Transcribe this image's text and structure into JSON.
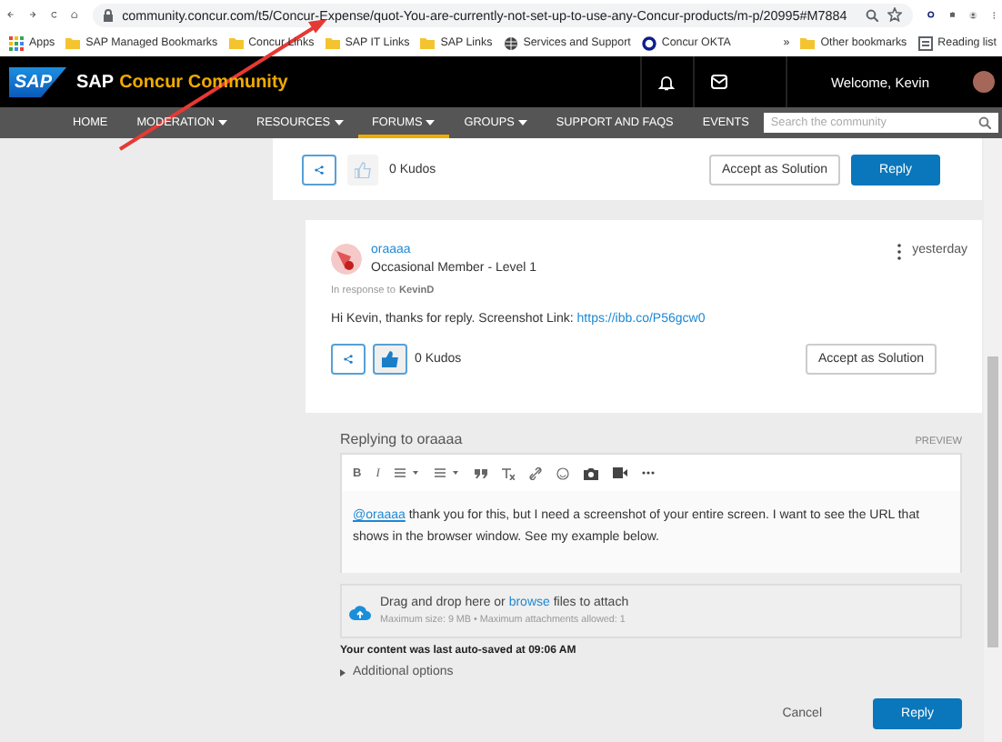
{
  "browser": {
    "url": "community.concur.com/t5/Concur-Expense/quot-You-are-currently-not-set-up-to-use-any-Concur-products/m-p/20995#M7884",
    "bookmarks": [
      {
        "kind": "apps",
        "label": "Apps"
      },
      {
        "kind": "folder",
        "label": "SAP Managed Bookmarks"
      },
      {
        "kind": "folder",
        "label": "Concur Links"
      },
      {
        "kind": "folder",
        "label": "SAP IT Links"
      },
      {
        "kind": "folder",
        "label": "SAP Links"
      },
      {
        "kind": "globe",
        "label": "Services and Support"
      },
      {
        "kind": "ring",
        "label": "Concur OKTA"
      }
    ],
    "overflow": "»",
    "other_bookmarks": "Other bookmarks",
    "reading_list": "Reading list"
  },
  "header": {
    "logo": "SAP",
    "title_brand": "SAP",
    "title_rest": "Concur Community",
    "welcome": "Welcome, Kevin"
  },
  "nav": {
    "items": [
      {
        "label": "HOME",
        "dropdown": false,
        "selected": false
      },
      {
        "label": "MODERATION",
        "dropdown": true,
        "selected": false
      },
      {
        "label": "RESOURCES",
        "dropdown": true,
        "selected": false
      },
      {
        "label": "FORUMS",
        "dropdown": true,
        "selected": true
      },
      {
        "label": "GROUPS",
        "dropdown": true,
        "selected": false
      },
      {
        "label": "SUPPORT AND FAQS",
        "dropdown": false,
        "selected": false
      },
      {
        "label": "EVENTS",
        "dropdown": false,
        "selected": false
      }
    ],
    "search": {
      "placeholder": "Search the community"
    }
  },
  "posts": [
    {
      "kudos": "0 Kudos",
      "kudo_disabled": true,
      "accept": "Accept as Solution",
      "reply": "Reply"
    },
    {
      "author": "oraaaa",
      "rank": "Occasional Member - Level 1",
      "time": "yesterday",
      "in_response_label": "In response to",
      "in_response_to": "KevinD",
      "body": "Hi Kevin, thanks for reply.  Screenshot Link:",
      "link": "https://ibb.co/P56gcw0",
      "kudos": "0 Kudos",
      "kudo_disabled": false,
      "accept": "Accept as Solution"
    }
  ],
  "reply": {
    "heading": "Replying to oraaaa",
    "preview": "PREVIEW",
    "toolbar": [
      {
        "kind": "bold",
        "label": "B"
      },
      {
        "kind": "italic",
        "label": "I"
      },
      {
        "kind": "bullets"
      },
      {
        "kind": "numbers"
      },
      {
        "kind": "quote"
      },
      {
        "kind": "clear"
      },
      {
        "kind": "link"
      },
      {
        "kind": "emoji"
      },
      {
        "kind": "camera"
      },
      {
        "kind": "video"
      },
      {
        "kind": "more"
      }
    ],
    "mention": "@oraaaa",
    "text": "thank you for this, but I need a screenshot of your entire screen. I want to see the URL that shows in the browser window. See my example below.",
    "attach_before": "Drag and drop here or",
    "attach_link": "browse",
    "attach_after": "files to attach",
    "limits": "Maximum size: 9 MB • Maximum attachments allowed: 1",
    "autosave": "Your content was last auto-saved at 09:06 AM",
    "additional": "Additional options",
    "cancel": "Cancel",
    "submit": "Reply"
  }
}
